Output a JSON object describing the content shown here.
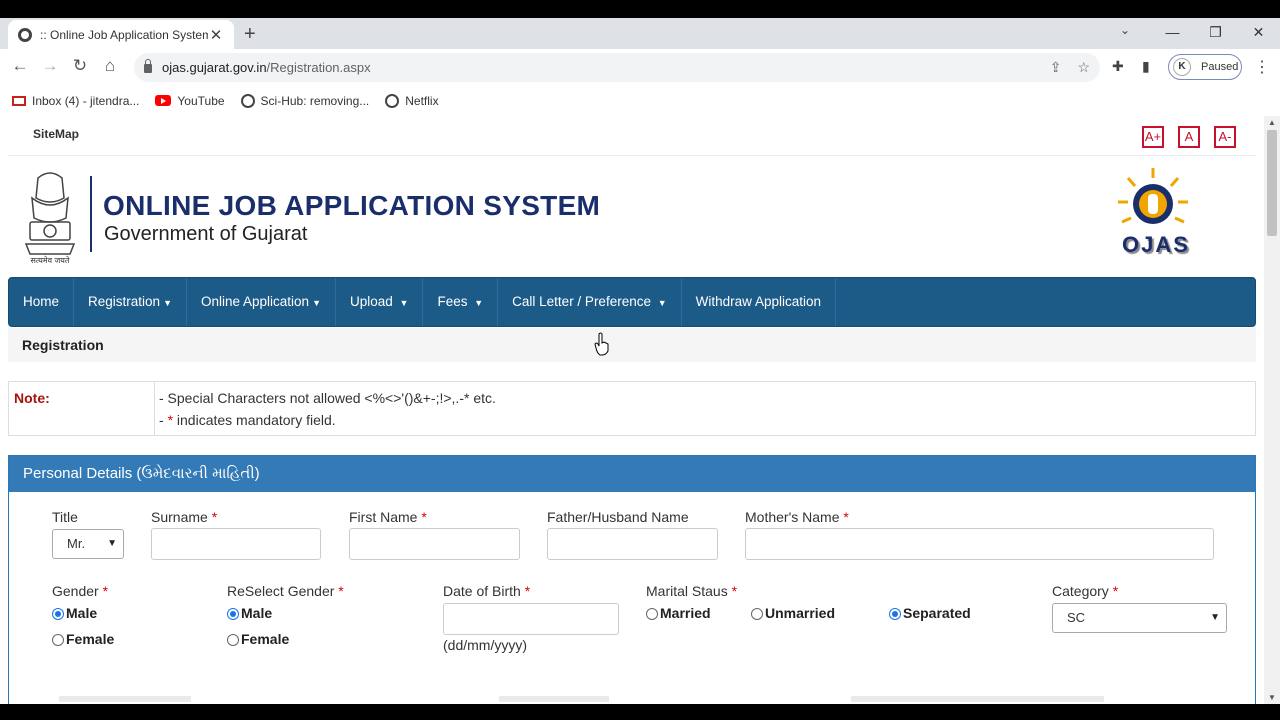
{
  "browser": {
    "tab_title": ":: Online Job Application System",
    "url_host": "ojas.gujarat.gov.in",
    "url_path": "/Registration.aspx",
    "profile_initial": "K",
    "profile_status": "Paused",
    "bookmarks": [
      {
        "label": "Inbox (4) - jitendra...",
        "icon": "gmail-icon"
      },
      {
        "label": "YouTube",
        "icon": "youtube-icon"
      },
      {
        "label": "Sci-Hub: removing...",
        "icon": "globe-icon"
      },
      {
        "label": "Netflix",
        "icon": "globe-icon"
      }
    ]
  },
  "page": {
    "sitemap": "SiteMap",
    "font_buttons": [
      "A+",
      "A",
      "A-"
    ],
    "title": "ONLINE JOB APPLICATION SYSTEM",
    "subtitle": "Government of Gujarat",
    "emblem_motto": "सत्यमेव जयते",
    "logo_text": "OJAS",
    "nav": [
      {
        "label": "Home",
        "dropdown": false
      },
      {
        "label": "Registration",
        "dropdown": true
      },
      {
        "label": "Online Application",
        "dropdown": true
      },
      {
        "label": "Upload",
        "dropdown": true
      },
      {
        "label": "Fees",
        "dropdown": true
      },
      {
        "label": "Call Letter / Preference",
        "dropdown": true
      },
      {
        "label": "Withdraw Application",
        "dropdown": false
      }
    ],
    "breadcrumb": "Registration",
    "note": {
      "label": "Note:",
      "line1": "- Special Characters not allowed <%<>'()&+-;!>,.-* etc.",
      "line2_prefix": "- ",
      "line2_star": "*",
      "line2_rest": " indicates mandatory field."
    },
    "personal": {
      "heading": "Personal Details (ઉમેદવારની માહિતી)",
      "title_label": "Title",
      "title_value": "Mr.",
      "surname_label": "Surname",
      "firstname_label": "First Name",
      "father_label": "Father/Husband Name",
      "mother_label": "Mother's Name",
      "gender_label": "Gender",
      "reselect_gender_label": "ReSelect Gender",
      "dob_label": "Date of Birth",
      "dob_hint": "(dd/mm/yyyy)",
      "marital_label": "Marital Staus",
      "category_label": "Category",
      "category_value": "SC",
      "required_mark": "*",
      "gender_options": [
        "Male",
        "Female"
      ],
      "gender_selected": "Male",
      "reselect_selected": "Male",
      "marital_options": [
        "Married",
        "Unmarried",
        "Separated"
      ],
      "marital_selected": "Separated"
    }
  }
}
